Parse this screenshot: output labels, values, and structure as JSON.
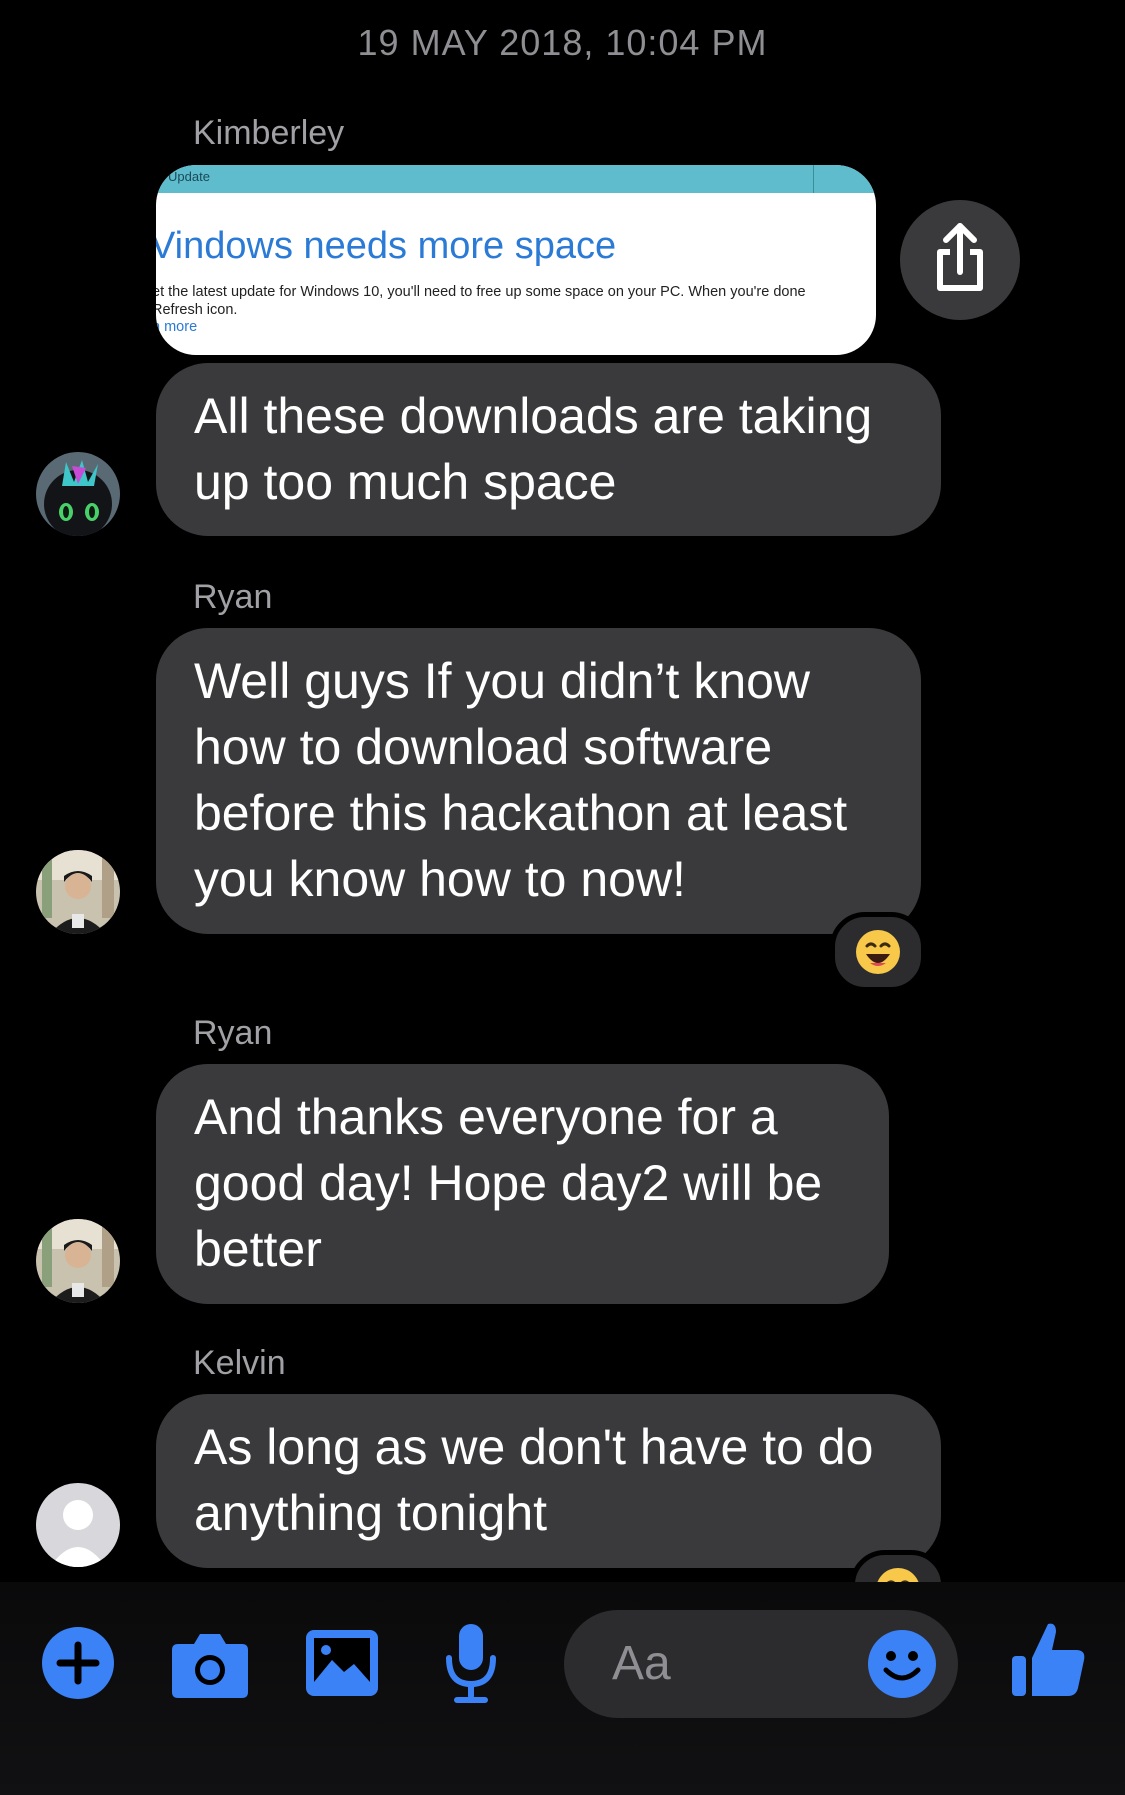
{
  "timestamp": "19 MAY 2018, 10:04 PM",
  "accent_color": "#3b82f6",
  "bubble_color": "#3a3a3c",
  "messages": [
    {
      "sender": "Kimberley",
      "shared_image": {
        "bar_title": "Update",
        "heading": "Vindows needs more space",
        "body_line1": "et the latest update for Windows 10, you'll need to free up some space on your PC. When you're done",
        "body_line2": "Refresh icon.",
        "link": "n more"
      },
      "text": "All these downloads are taking up too much space",
      "avatar": "kimberley-avatar"
    },
    {
      "sender": "Ryan",
      "text": "Well guys If you didn’t know how to download software before this hackathon at least you know how to now!",
      "reaction": "laughing-emoji",
      "avatar": "ryan-avatar"
    },
    {
      "sender": "Ryan",
      "text": "And thanks everyone for a good day! Hope day2 will be better",
      "avatar": "ryan-avatar"
    },
    {
      "sender": "Kelvin",
      "text": "As long as we don't have to do anything tonight",
      "reaction": "laughing-emoji",
      "avatar": "default-avatar"
    }
  ],
  "composer": {
    "placeholder": "Aa",
    "icons": [
      "plus-icon",
      "camera-icon",
      "photo-icon",
      "microphone-icon",
      "emoji-icon",
      "thumbs-up-icon"
    ]
  }
}
